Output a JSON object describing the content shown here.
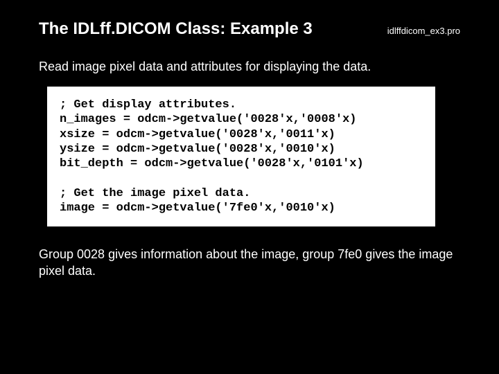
{
  "header": {
    "title": "The IDLff.DICOM Class: Example 3",
    "filename": "idlffdicom_ex3.pro"
  },
  "intro": "Read image pixel data and attributes for displaying the data.",
  "code": "; Get display attributes.\nn_images = odcm->getvalue('0028'x,'0008'x)\nxsize = odcm->getvalue('0028'x,'0011'x)\nysize = odcm->getvalue('0028'x,'0010'x)\nbit_depth = odcm->getvalue('0028'x,'0101'x)\n\n; Get the image pixel data.\nimage = odcm->getvalue('7fe0'x,'0010'x)",
  "outro": "Group 0028 gives information about the image, group 7fe0 gives the image pixel data."
}
